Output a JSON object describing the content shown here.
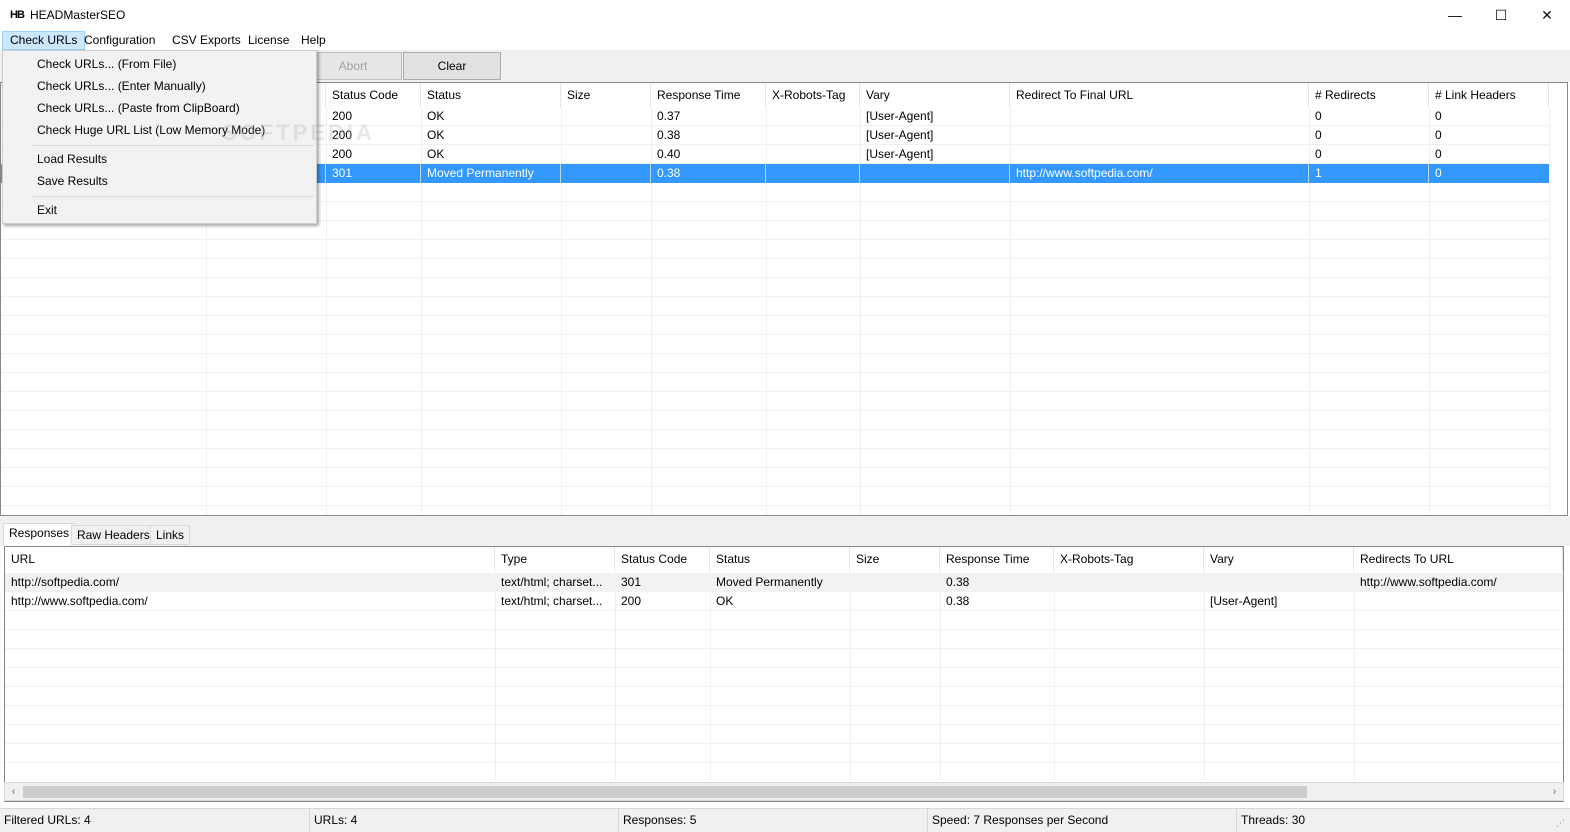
{
  "window": {
    "title": "HEADMasterSEO",
    "logo": "HB",
    "minimize": "—",
    "maximize": "☐",
    "close": "✕"
  },
  "menubar": [
    "Check URLs",
    "Configuration",
    "CSV Exports",
    "License",
    "Help"
  ],
  "toolbar": {
    "abort_label": "Abort",
    "clear_label": "Clear"
  },
  "dropdown": {
    "items": [
      "Check URLs... (From File)",
      "Check URLs... (Enter Manually)",
      "Check URLs... (Paste from ClipBoard)",
      "Check Huge URL List (Low Memory Mode)",
      "Load Results",
      "Save Results",
      "Exit"
    ]
  },
  "watermark": "SOFTPEDIA",
  "top_grid": {
    "columns": [
      "Status Code",
      "Status",
      "Size",
      "Response Time",
      "X-Robots-Tag",
      "Vary",
      "Redirect To Final URL",
      "# Redirects",
      "# Link Headers"
    ],
    "rows": [
      [
        "200",
        "OK",
        "",
        "0.37",
        "",
        "[User-Agent]",
        "",
        "0",
        "0"
      ],
      [
        "200",
        "OK",
        "",
        "0.38",
        "",
        "[User-Agent]",
        "",
        "0",
        "0"
      ],
      [
        "200",
        "OK",
        "",
        "0.40",
        "",
        "[User-Agent]",
        "",
        "0",
        "0"
      ],
      [
        "301",
        "Moved Permanently",
        "",
        "0.38",
        "",
        "",
        "http://www.softpedia.com/",
        "1",
        "0"
      ]
    ]
  },
  "tabs": [
    "Responses",
    "Raw Headers",
    "Links"
  ],
  "bottom_grid": {
    "columns": [
      "URL",
      "Type",
      "Status Code",
      "Status",
      "Size",
      "Response Time",
      "X-Robots-Tag",
      "Vary",
      "Redirects To URL"
    ],
    "rows": [
      [
        "http://softpedia.com/",
        "text/html; charset...",
        "301",
        "Moved Permanently",
        "",
        "0.38",
        "",
        "",
        "http://www.softpedia.com/"
      ],
      [
        "http://www.softpedia.com/",
        "text/html; charset...",
        "200",
        "OK",
        "",
        "0.38",
        "",
        "[User-Agent]",
        ""
      ]
    ]
  },
  "scroll": {
    "left": "‹",
    "right": "›"
  },
  "statusbar": {
    "filtered": "Filtered URLs: 4",
    "urls": "URLs: 4",
    "responses": "Responses: 5",
    "speed": "Speed: 7 Responses per Second",
    "threads": "Threads: 30"
  },
  "colors": {
    "selection": "#3399ff",
    "menu_active": "#cce8ff"
  }
}
